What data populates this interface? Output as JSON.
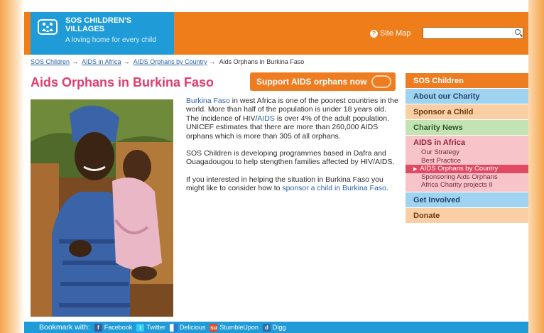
{
  "header": {
    "logo_name": "SOS CHILDREN'S VILLAGES",
    "logo_tagline": "A loving home for every child",
    "sitemap_label": "Site Map",
    "search_value": "",
    "colors": {
      "header": "#ef7d1a",
      "logo_block": "#1f9bd7"
    }
  },
  "breadcrumb": {
    "items": [
      "SOS Children",
      "AIDS in Africa",
      "AIDS Orphans by Country"
    ],
    "current": "Aids Orphans in Burkina Faso",
    "separator": "→"
  },
  "main": {
    "title": "Aids Orphans in Burkina Faso",
    "support_button": "Support AIDS orphans now",
    "p1": {
      "link1": "Burkina Faso",
      "t1": " in west Africa is one of the poorest countries in the world. More than half of the population is under 18 years old. The incidence of HIV/",
      "link2": "AIDS",
      "t2": " is over 4% of the adult population. UNICEF estimates that there are more than 260,000 AIDS orphans which is more than 305 of all orphans."
    },
    "p2": "SOS Children is developing programmes based in Dafra and Ouagadougou to help stengthen families affected by HIV/AIDS.",
    "p3": {
      "t1": "If you interested in helping the situation in Burkina Faso you might like to consider how to ",
      "link": "sponsor a child in Burkina Faso",
      "t2": "."
    }
  },
  "sidebar": {
    "items": [
      {
        "label": "SOS Children"
      },
      {
        "label": "About our Charity"
      },
      {
        "label": "Sponsor a Child"
      },
      {
        "label": "Charity News"
      }
    ],
    "section": {
      "label": "AIDS in Africa",
      "subitems": [
        "Our Strategy",
        "Best Practice",
        "AIDS Orphans by Country",
        "Sponsoring Aids Orphans",
        "Africa Charity projects II"
      ],
      "active_index": 2
    },
    "items2": [
      {
        "label": "Get Involved"
      },
      {
        "label": "Donate"
      }
    ]
  },
  "footer": {
    "bookmark_label": "Bookmark with:",
    "services": [
      {
        "label": "Facebook",
        "icon": "facebook-icon",
        "color": "#3b5998"
      },
      {
        "label": "Twitter",
        "icon": "twitter-icon",
        "color": "#33ccff"
      },
      {
        "label": "Delicious",
        "icon": "delicious-icon",
        "color": "#3274d1"
      },
      {
        "label": "StumbleUpon",
        "icon": "stumbleupon-icon",
        "color": "#eb4924"
      },
      {
        "label": "Digg",
        "icon": "digg-icon",
        "color": "#2d6ca2"
      }
    ]
  }
}
